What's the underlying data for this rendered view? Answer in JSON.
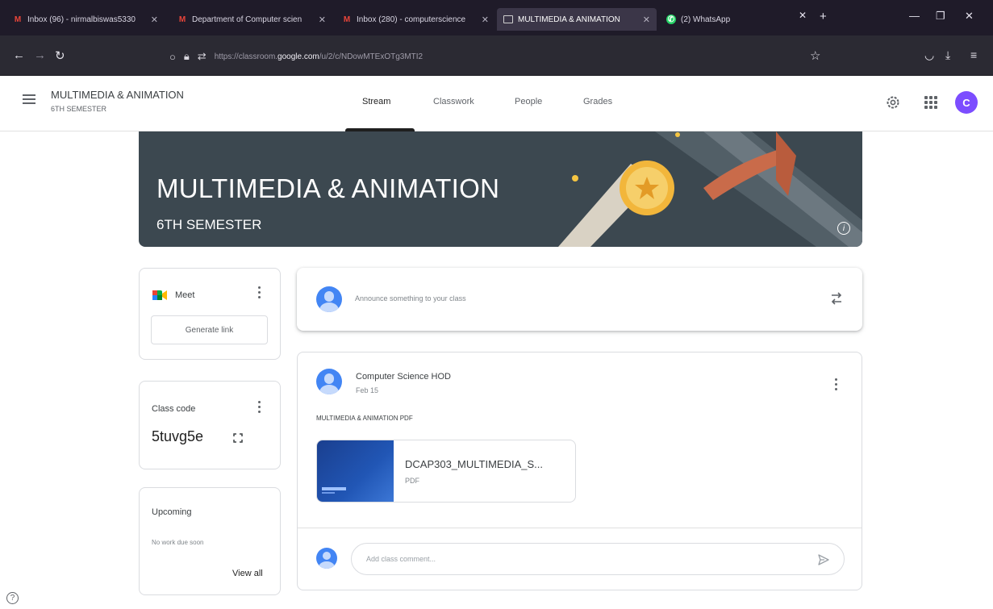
{
  "browser": {
    "tabs": [
      {
        "title": "Inbox (96) - nirmalbiswas5330",
        "icon": "gmail-icon"
      },
      {
        "title": "Department of Computer scien",
        "icon": "gmail-icon"
      },
      {
        "title": "Inbox (280) - computerscience",
        "icon": "gmail-icon"
      },
      {
        "title": "MULTIMEDIA & ANIMATION",
        "icon": "classroom-icon",
        "active": true
      },
      {
        "title": "(2) WhatsApp",
        "icon": "whatsapp-icon"
      }
    ],
    "url_prefix": "https://classroom.",
    "url_domain": "google.com",
    "url_suffix": "/u/2/c/NDowMTExOTg3MTI2"
  },
  "header": {
    "class_name": "MULTIMEDIA & ANIMATION",
    "section": "6TH SEMESTER",
    "tabs": [
      "Stream",
      "Classwork",
      "People",
      "Grades"
    ],
    "active_tab": "Stream",
    "avatar_letter": "C"
  },
  "banner": {
    "title": "MULTIMEDIA & ANIMATION",
    "subtitle": "6TH SEMESTER"
  },
  "meet": {
    "label": "Meet",
    "button": "Generate link"
  },
  "class_code": {
    "label": "Class code",
    "code": "5tuvg5e"
  },
  "upcoming": {
    "label": "Upcoming",
    "empty_text": "No work due soon",
    "link": "View all"
  },
  "announce": {
    "placeholder": "Announce something to your class"
  },
  "post": {
    "author": "Computer Science HOD",
    "date": "Feb 15",
    "text": "MULTIMEDIA & ANIMATION PDF",
    "attachment_name": "DCAP303_MULTIMEDIA_S...",
    "attachment_type": "PDF",
    "comment_placeholder": "Add class comment..."
  },
  "colors": {
    "banner_bg": "#3c4850",
    "accent_purple": "#7c4dff",
    "avatar_blue": "#4285f4"
  }
}
